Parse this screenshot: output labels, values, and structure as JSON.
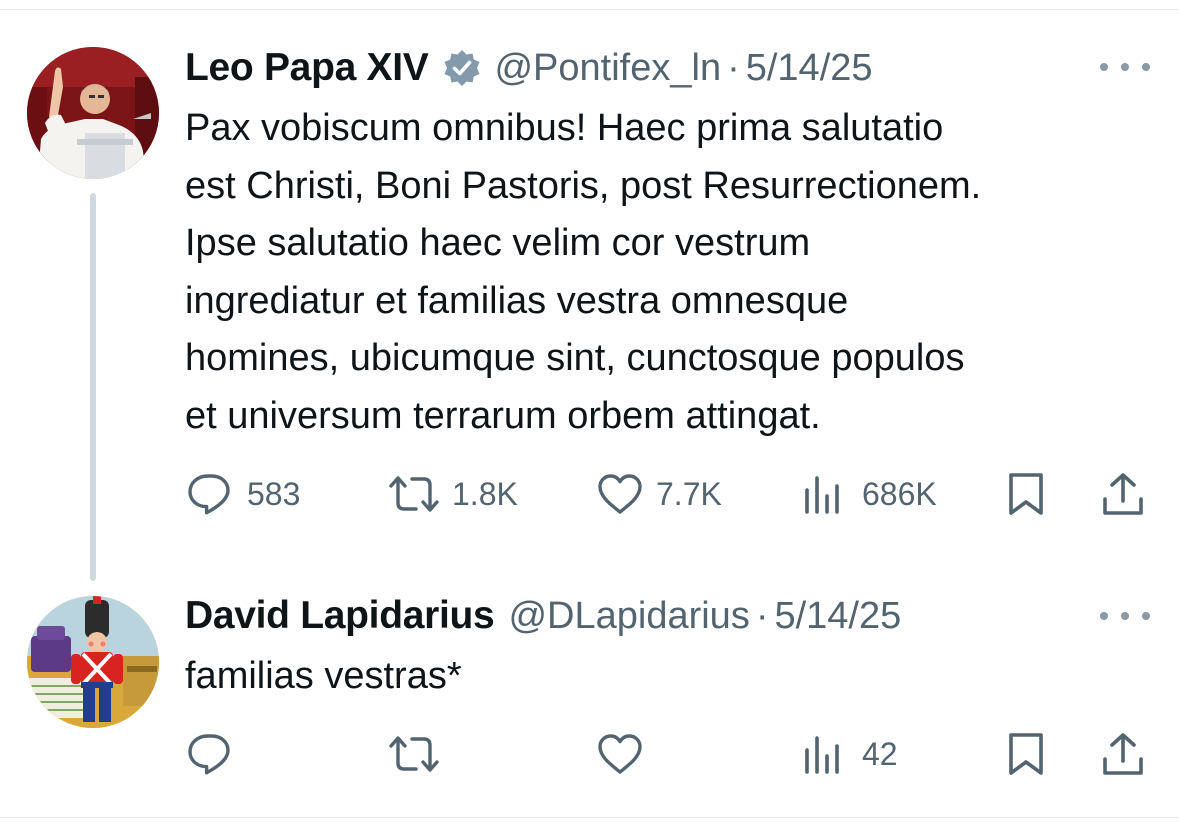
{
  "tweets": [
    {
      "author_name": "Leo Papa XIV",
      "verified": true,
      "handle": "@Pontifex_ln",
      "separator": "·",
      "date": "5/14/25",
      "text_lines": [
        "Pax vobiscum omnibus! Haec prima salutatio",
        "est Christi, Boni Pastoris, post Resurrectionem.",
        "Ipse salutatio haec velim cor vestrum",
        "ingrediatur et familias vestra omnesque",
        "homines, ubicumque sint, cunctosque populos",
        "et universum terrarum orbem attingat."
      ],
      "stats": {
        "replies": "583",
        "reposts": "1.8K",
        "likes": "7.7K",
        "views": "686K"
      }
    },
    {
      "author_name": "David Lapidarius",
      "verified": false,
      "handle": "@DLapidarius",
      "separator": "·",
      "date": "5/14/25",
      "text_lines": [
        "familias vestras*"
      ],
      "stats": {
        "replies": "",
        "reposts": "",
        "likes": "",
        "views": "42"
      }
    }
  ],
  "icons": {
    "reply": "reply-icon",
    "repost": "repost-icon",
    "like": "heart-icon",
    "views": "views-icon",
    "bookmark": "bookmark-icon",
    "share": "share-icon",
    "more": "more-icon",
    "verified": "verified-badge-icon"
  },
  "colors": {
    "text": "#0f1419",
    "secondary": "#536471",
    "verified_badge": "#829aab",
    "thread_line": "#cfd9de"
  }
}
